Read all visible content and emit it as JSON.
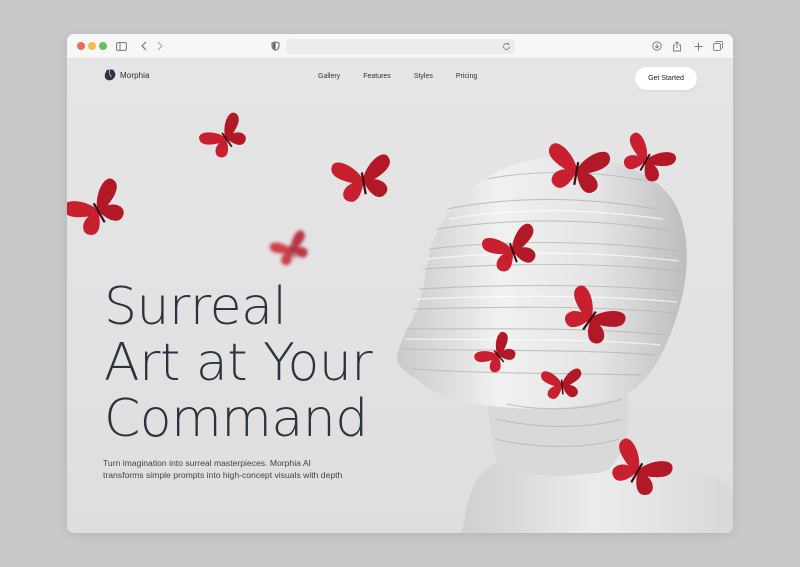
{
  "browser": {
    "traffic_lights": {
      "close": "#ee6a5f",
      "minimize": "#f5bd4f",
      "maximize": "#61c454"
    },
    "icons": [
      "sidebar-icon",
      "back-icon",
      "forward-icon",
      "shield-icon",
      "reload-icon",
      "download-icon",
      "share-icon",
      "new-tab-icon",
      "tabs-overview-icon"
    ],
    "url": ""
  },
  "header": {
    "brand": {
      "name": "Morphia",
      "logo_icon": "morphia-logo-icon"
    },
    "nav": [
      "Gallery",
      "Features",
      "Styles",
      "Pricing"
    ],
    "cta_label": "Get Started"
  },
  "hero": {
    "title_lines": [
      "Surreal",
      "Art at Your",
      "Command"
    ],
    "subtitle": "Turn imagination into surreal masterpieces. Morphia AI transforms simple prompts into high-concept visuals with depth"
  },
  "colors": {
    "background": "#c7c9ca",
    "page": "#e5e5e5",
    "text_dark": "#2a3440",
    "butterfly_red": "#c8202e"
  }
}
